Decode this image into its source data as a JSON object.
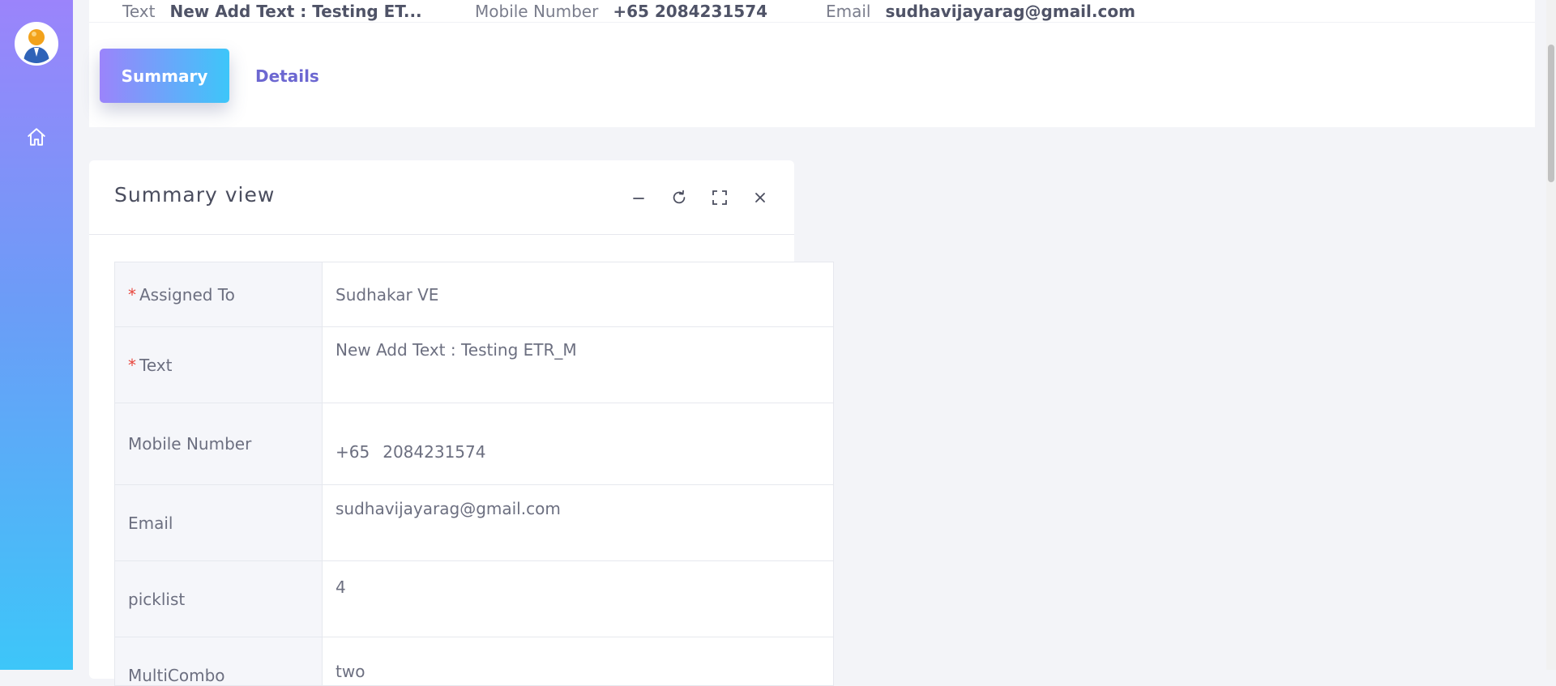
{
  "header": {
    "info": [
      {
        "label": "Text",
        "value": "New Add Text : Testing ET..."
      },
      {
        "label": "Mobile Number",
        "value": "+65 2084231574"
      },
      {
        "label": "Email",
        "value": "sudhavijayarag@gmail.com"
      }
    ],
    "tabs": [
      {
        "label": "Summary",
        "active": true
      },
      {
        "label": "Details",
        "active": false
      }
    ]
  },
  "panel": {
    "title": "Summary view",
    "tools": [
      "minimize-icon",
      "refresh-icon",
      "fullscreen-icon",
      "close-icon"
    ]
  },
  "fields": {
    "assigned_to": {
      "label": "Assigned To",
      "required_mark": "*",
      "value": "Sudhakar VE"
    },
    "text": {
      "label": "Text",
      "required_mark": "*",
      "value": "New Add Text : Testing ETR_M"
    },
    "mobile": {
      "label": "Mobile Number",
      "country_code": "+65",
      "number": "2084231574"
    },
    "email": {
      "label": "Email",
      "value": "sudhavijayarag@gmail.com"
    },
    "picklist": {
      "label": "picklist",
      "value": "4"
    },
    "multicombo": {
      "label": "MultiCombo",
      "value": "two"
    }
  },
  "sidebar": {
    "items": [
      {
        "icon": "home-icon"
      }
    ]
  },
  "colors": {
    "accent": "#6c67d1",
    "gradient_start": "#9b84fb",
    "gradient_end": "#3dc6f9",
    "required": "#e8453c"
  }
}
